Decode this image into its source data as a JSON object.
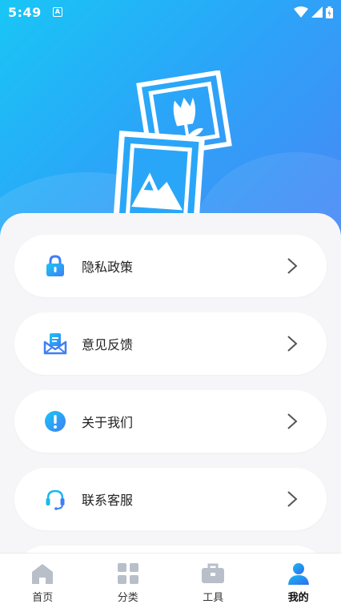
{
  "status_bar": {
    "time": "5:49",
    "badge": "A"
  },
  "menu": [
    {
      "label": "隐私政策",
      "icon": "lock-icon"
    },
    {
      "label": "意见反馈",
      "icon": "feedback-mail-icon"
    },
    {
      "label": "关于我们",
      "icon": "info-alert-icon"
    },
    {
      "label": "联系客服",
      "icon": "headset-icon"
    }
  ],
  "tabs": [
    {
      "label": "首页",
      "icon": "home-icon"
    },
    {
      "label": "分类",
      "icon": "grid-icon"
    },
    {
      "label": "工具",
      "icon": "toolbox-icon"
    },
    {
      "label": "我的",
      "icon": "person-icon",
      "active": true
    }
  ],
  "colors": {
    "accent": "#2196f3",
    "hero_start": "#19c6f5",
    "hero_end": "#4a86f5",
    "inactive_icon": "#b8bfc9"
  }
}
